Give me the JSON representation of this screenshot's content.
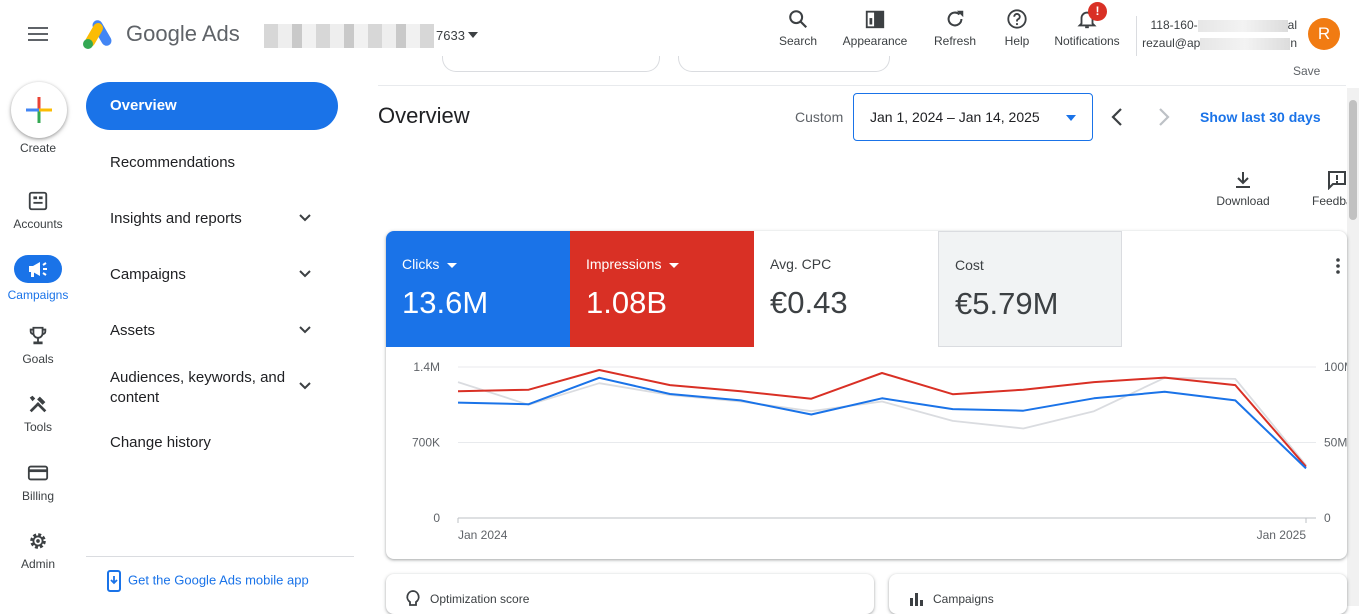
{
  "header": {
    "brand": "Google Ads",
    "account_suffix": "7633",
    "tools": [
      {
        "label": "Search",
        "icon": "search-icon"
      },
      {
        "label": "Appearance",
        "icon": "appearance-icon"
      },
      {
        "label": "Refresh",
        "icon": "refresh-icon"
      },
      {
        "label": "Help",
        "icon": "help-icon"
      },
      {
        "label": "Notifications",
        "icon": "bell-icon"
      }
    ],
    "notification_badge": "!",
    "user_line1_start": "118-160-",
    "user_line1_end": "al",
    "user_line2_start": "rezaul@ap",
    "user_line2_end": "n",
    "avatar_initial": "R",
    "avatar_color": "#f17b12"
  },
  "rail": {
    "items": [
      {
        "label": "Create",
        "icon": "plus-icon"
      },
      {
        "label": "Accounts",
        "icon": "accounts-icon"
      },
      {
        "label": "Campaigns",
        "icon": "megaphone-icon",
        "active": true
      },
      {
        "label": "Goals",
        "icon": "trophy-icon"
      },
      {
        "label": "Tools",
        "icon": "tools-icon"
      },
      {
        "label": "Billing",
        "icon": "card-icon"
      },
      {
        "label": "Admin",
        "icon": "gear-icon"
      }
    ]
  },
  "nav": {
    "items": [
      {
        "label": "Overview",
        "active": true
      },
      {
        "label": "Recommendations"
      },
      {
        "label": "Insights and reports",
        "expandable": true
      },
      {
        "label": "Campaigns",
        "expandable": true
      },
      {
        "label": "Assets",
        "expandable": true
      },
      {
        "label": "Audiences, keywords, and content",
        "expandable": true
      },
      {
        "label": "Change history"
      }
    ],
    "mobile_app_link": "Get the Google Ads mobile app"
  },
  "overview": {
    "title": "Overview",
    "save_partial": "Save",
    "date_mode": "Custom",
    "date_range": "Jan 1, 2024 – Jan 14, 2025",
    "show_last": "Show last 30 days",
    "actions": [
      {
        "label": "Download",
        "icon": "download-icon"
      },
      {
        "label": "Feedba",
        "icon": "feedback-icon"
      }
    ]
  },
  "metrics": [
    {
      "label": "Clicks",
      "value": "13.6M",
      "color": "#1a73e8",
      "selected": true
    },
    {
      "label": "Impressions",
      "value": "1.08B",
      "color": "#d93025",
      "selected": true
    },
    {
      "label": "Avg. CPC",
      "value": "€0.43"
    },
    {
      "label": "Cost",
      "value": "€5.79M",
      "hovered": true
    }
  ],
  "chart_data": {
    "type": "line",
    "x_labels": [
      "Jan 2024",
      "Jan 2025"
    ],
    "y_left_ticks": [
      "1.4M",
      "700K",
      "0"
    ],
    "y_right_ticks": [
      "100M",
      "50M",
      "0"
    ],
    "y_left_range": [
      0,
      1400000
    ],
    "y_right_range": [
      0,
      100000000
    ],
    "grid": true,
    "series": [
      {
        "name": "Clicks",
        "axis": "left",
        "color": "#1a73e8",
        "values": [
          1070000,
          1055000,
          1300000,
          1150000,
          1090000,
          960000,
          1110000,
          1010000,
          995000,
          1110000,
          1170000,
          1090000,
          460000
        ]
      },
      {
        "name": "Impressions",
        "axis": "right",
        "color": "#d93025",
        "values": [
          84000000,
          85000000,
          98000000,
          88000000,
          84000000,
          79000000,
          96000000,
          82000000,
          85000000,
          90000000,
          93000000,
          88000000,
          34000000
        ]
      },
      {
        "name": "Clicks (comparison)",
        "axis": "left",
        "color": "#dadce0",
        "values": [
          1260000,
          1050000,
          1250000,
          1140000,
          1080000,
          990000,
          1080000,
          900000,
          830000,
          990000,
          1300000,
          1290000,
          490000
        ]
      }
    ]
  },
  "bottom_cards": [
    {
      "label": "Optimization score",
      "icon": "lightbulb-icon"
    },
    {
      "label": "Campaigns",
      "icon": "bar-chart-icon"
    }
  ]
}
